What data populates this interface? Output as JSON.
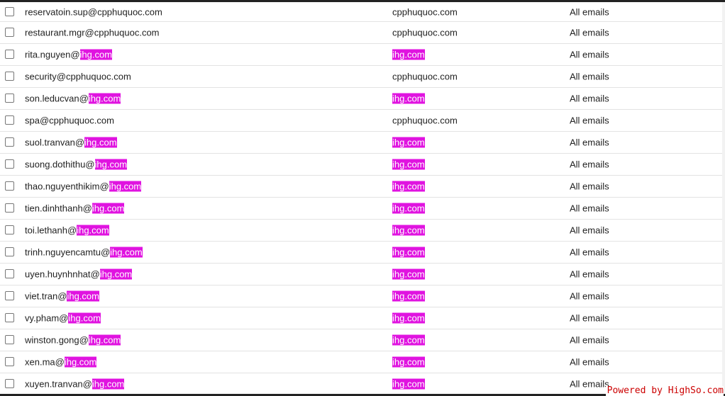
{
  "rows": [
    {
      "local": "reservatoin.sup@cpphuquoc.com",
      "domain_part": "",
      "domain": "cpphuquoc.com",
      "domain_highlight": false,
      "scope": "All emails"
    },
    {
      "local": "restaurant.mgr@cpphuquoc.com",
      "domain_part": "",
      "domain": "cpphuquoc.com",
      "domain_highlight": false,
      "scope": "All emails"
    },
    {
      "local": "rita.nguyen@",
      "domain_part": "ihg.com",
      "domain": "ihg.com",
      "domain_highlight": true,
      "scope": "All emails"
    },
    {
      "local": "security@cpphuquoc.com",
      "domain_part": "",
      "domain": "cpphuquoc.com",
      "domain_highlight": false,
      "scope": "All emails"
    },
    {
      "local": "son.leducvan@",
      "domain_part": "ihg.com",
      "domain": "ihg.com",
      "domain_highlight": true,
      "scope": "All emails"
    },
    {
      "local": "spa@cpphuquoc.com",
      "domain_part": "",
      "domain": "cpphuquoc.com",
      "domain_highlight": false,
      "scope": "All emails"
    },
    {
      "local": "suol.tranvan@",
      "domain_part": "ihg.com",
      "domain": "ihg.com",
      "domain_highlight": true,
      "scope": "All emails"
    },
    {
      "local": "suong.dothithu@",
      "domain_part": "ihg.com",
      "domain": "ihg.com",
      "domain_highlight": true,
      "scope": "All emails"
    },
    {
      "local": "thao.nguyenthikim@",
      "domain_part": "ihg.com",
      "domain": "ihg.com",
      "domain_highlight": true,
      "scope": "All emails"
    },
    {
      "local": "tien.dinhthanh@",
      "domain_part": "ihg.com",
      "domain": "ihg.com",
      "domain_highlight": true,
      "scope": "All emails"
    },
    {
      "local": "toi.lethanh@",
      "domain_part": "ihg.com",
      "domain": "ihg.com",
      "domain_highlight": true,
      "scope": "All emails"
    },
    {
      "local": "trinh.nguyencamtu@",
      "domain_part": "ihg.com",
      "domain": "ihg.com",
      "domain_highlight": true,
      "scope": "All emails"
    },
    {
      "local": "uyen.huynhnhat@",
      "domain_part": "ihg.com",
      "domain": "ihg.com",
      "domain_highlight": true,
      "scope": "All emails"
    },
    {
      "local": "viet.tran@",
      "domain_part": "ihg.com",
      "domain": "ihg.com",
      "domain_highlight": true,
      "scope": "All emails"
    },
    {
      "local": "vy.pham@",
      "domain_part": "ihg.com",
      "domain": "ihg.com",
      "domain_highlight": true,
      "scope": "All emails"
    },
    {
      "local": "winston.gong@",
      "domain_part": "ihg.com",
      "domain": "ihg.com",
      "domain_highlight": true,
      "scope": "All emails"
    },
    {
      "local": "xen.ma@",
      "domain_part": "ihg.com",
      "domain": "ihg.com",
      "domain_highlight": true,
      "scope": "All emails"
    },
    {
      "local": "xuyen.tranvan@",
      "domain_part": "ihg.com",
      "domain": "ihg.com",
      "domain_highlight": true,
      "scope": "All emails"
    }
  ],
  "footer": {
    "powered_by": "Powered by HighSo.com"
  },
  "colors": {
    "highlight": "#e013e0",
    "powered_by": "#cc0000"
  }
}
